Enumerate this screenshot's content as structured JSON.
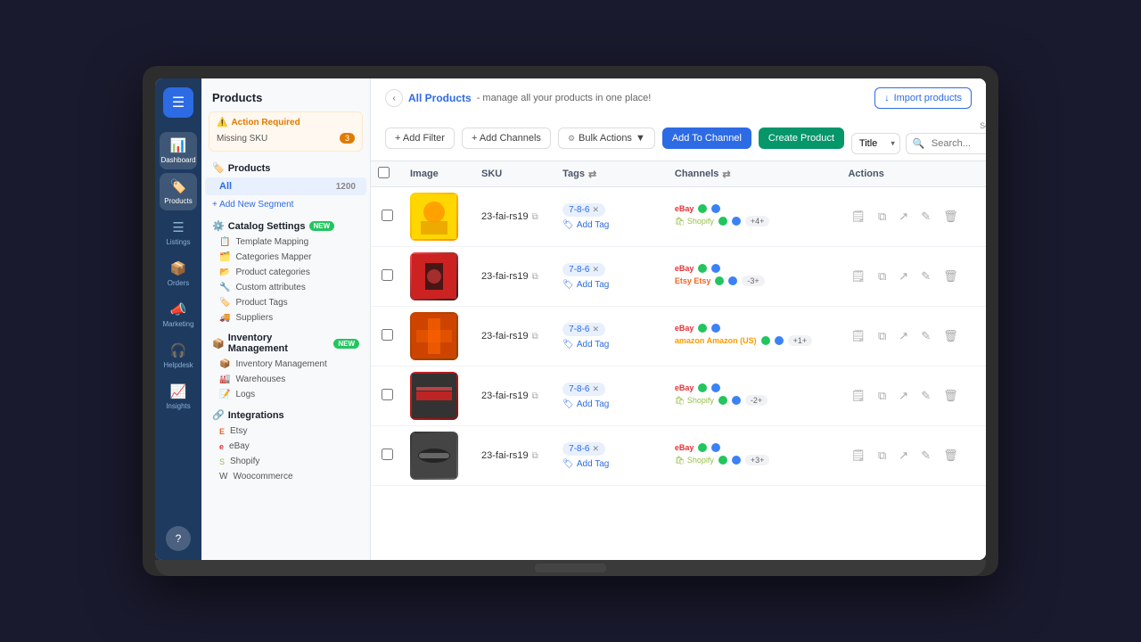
{
  "app": {
    "title": "Products"
  },
  "nav": {
    "logo_icon": "☰",
    "items": [
      {
        "id": "dashboard",
        "icon": "📊",
        "label": "Dashboard",
        "active": false
      },
      {
        "id": "products",
        "icon": "🏷️",
        "label": "Products",
        "active": true
      },
      {
        "id": "listings",
        "icon": "≡",
        "label": "Listings",
        "active": false
      },
      {
        "id": "orders",
        "icon": "📦",
        "label": "Orders",
        "active": false
      },
      {
        "id": "marketing",
        "icon": "📣",
        "label": "Marketing",
        "active": false
      },
      {
        "id": "helpdesk",
        "icon": "🎧",
        "label": "Helpdesk",
        "active": false
      },
      {
        "id": "insights",
        "icon": "📈",
        "label": "Insights",
        "active": false
      }
    ],
    "help_icon": "?"
  },
  "left_panel": {
    "alert": {
      "title": "Action Required",
      "icon": "⚠️",
      "items": [
        {
          "label": "Missing SKU",
          "count": "3"
        }
      ]
    },
    "products_section": {
      "label": "Products",
      "icon": "🏷️",
      "items": [
        {
          "label": "All",
          "count": "1200",
          "active": true
        }
      ],
      "add_segment": "+ Add New Segment"
    },
    "catalog_settings": {
      "label": "Catalog Settings",
      "icon": "⚙️",
      "badge": "NEW",
      "items": [
        {
          "icon": "📋",
          "label": "Template Mapping"
        },
        {
          "icon": "🗂️",
          "label": "Categories Mapper"
        },
        {
          "icon": "📂",
          "label": "Product categories"
        },
        {
          "icon": "🔧",
          "label": "Custom attributes"
        },
        {
          "icon": "🏷️",
          "label": "Product Tags"
        },
        {
          "icon": "🚚",
          "label": "Suppliers"
        }
      ]
    },
    "inventory": {
      "label": "Inventory Management",
      "icon": "📦",
      "badge": "NEW",
      "items": [
        {
          "icon": "📦",
          "label": "Inventory Management"
        },
        {
          "icon": "🏭",
          "label": "Warehouses"
        },
        {
          "icon": "📝",
          "label": "Logs"
        }
      ]
    },
    "integrations": {
      "label": "Integrations",
      "icon": "🔗",
      "items": [
        {
          "icon": "E",
          "label": "Etsy"
        },
        {
          "icon": "e",
          "label": "eBay"
        },
        {
          "icon": "S",
          "label": "Shopify"
        },
        {
          "icon": "W",
          "label": "Woocommerce"
        }
      ]
    }
  },
  "header": {
    "back_icon": "‹",
    "current_page": "All Products",
    "subtitle": "- manage all your products in one place!",
    "import_btn": "Import products",
    "import_icon": "↓"
  },
  "toolbar": {
    "add_filter": "+ Add Filter",
    "add_channels": "+ Add Channels",
    "bulk_actions": "Bulk Actions",
    "bulk_icon": "▼",
    "add_to_channel": "Add To Channel",
    "create_product": "Create Product",
    "search_type": "Search Type: Contains",
    "title_label": "Title",
    "search_placeholder": "Search...",
    "grid_icon": "⊞"
  },
  "table": {
    "columns": [
      "",
      "Image",
      "SKU",
      "Tags",
      "Channels",
      "Actions"
    ],
    "rows": [
      {
        "id": 1,
        "sku": "23-fai-rs19",
        "tag": "7-8-6",
        "channels": [
          {
            "name": "eBay",
            "logo": "eBay",
            "status1": "green",
            "status2": "blue"
          },
          {
            "name": "Shopify",
            "logo": "S",
            "status1": "green",
            "status2": "blue",
            "more": "+4+"
          }
        ],
        "img_class": "img-1"
      },
      {
        "id": 2,
        "sku": "23-fai-rs19",
        "tag": "7-8-6",
        "channels": [
          {
            "name": "eBay",
            "logo": "eBay",
            "status1": "green",
            "status2": "blue"
          },
          {
            "name": "Etsy",
            "logo": "Etsy",
            "status1": "green",
            "status2": "blue",
            "more": "-3+"
          }
        ],
        "img_class": "img-2"
      },
      {
        "id": 3,
        "sku": "23-fai-rs19",
        "tag": "7-8-6",
        "channels": [
          {
            "name": "eBay",
            "logo": "eBay",
            "status1": "green",
            "status2": "blue"
          },
          {
            "name": "Amazon (US)",
            "logo": "Amazon",
            "status1": "green",
            "status2": "blue",
            "more": "+1+"
          }
        ],
        "img_class": "img-3"
      },
      {
        "id": 4,
        "sku": "23-fai-rs19",
        "tag": "7-8-6",
        "channels": [
          {
            "name": "eBay",
            "logo": "eBay",
            "status1": "green",
            "status2": "blue"
          },
          {
            "name": "Shopify",
            "logo": "S",
            "status1": "green",
            "status2": "blue",
            "more": "-2+"
          }
        ],
        "img_class": "img-4"
      },
      {
        "id": 5,
        "sku": "23-fai-rs19",
        "tag": "7-8-6",
        "channels": [
          {
            "name": "eBay",
            "logo": "eBay",
            "status1": "green",
            "status2": "blue"
          },
          {
            "name": "Shopify",
            "logo": "S",
            "status1": "green",
            "status2": "blue",
            "more": "+3+"
          }
        ],
        "img_class": "img-5"
      }
    ],
    "add_tag_label": "Add Tag",
    "action_icons": [
      "🗒",
      "⧉",
      "↗",
      "✎",
      "🗑"
    ]
  }
}
